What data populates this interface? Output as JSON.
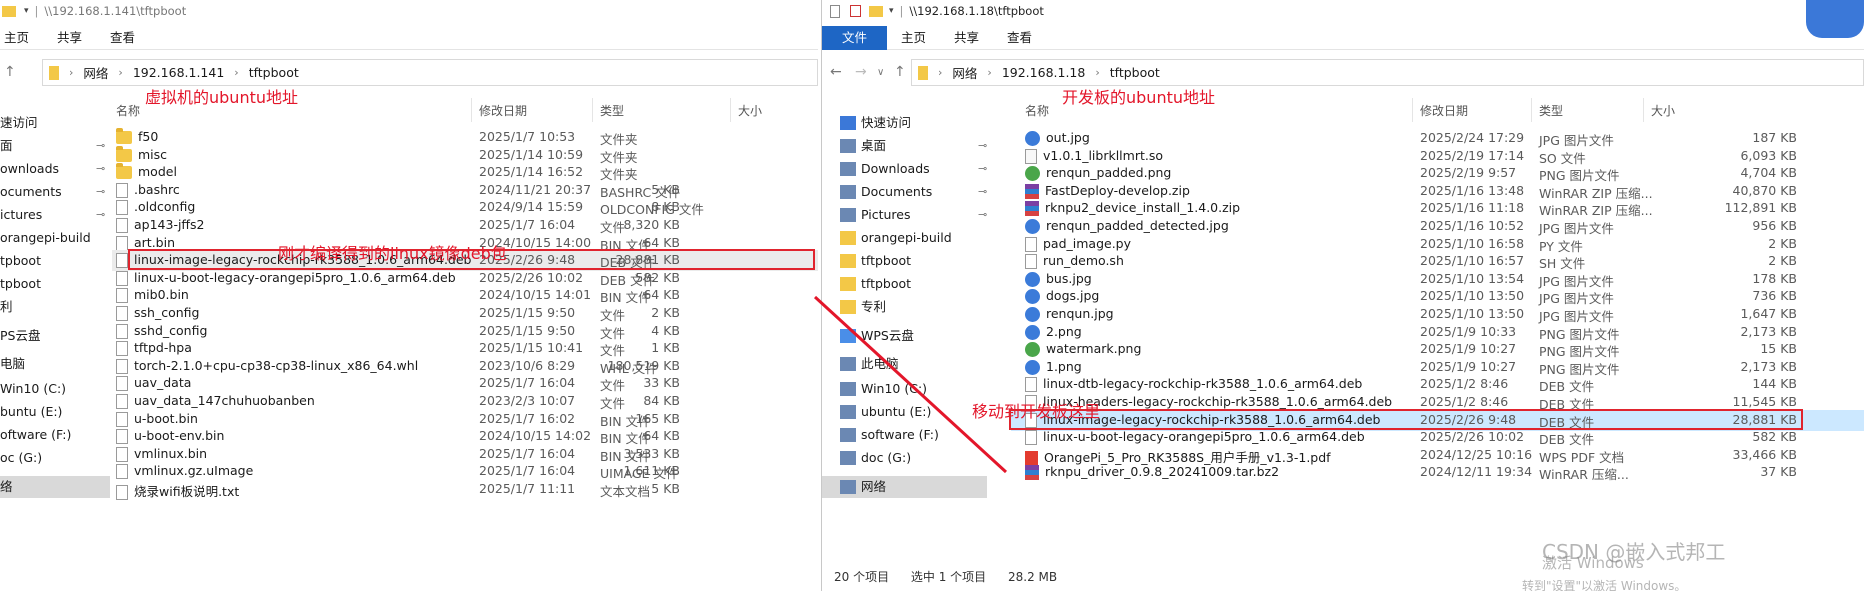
{
  "left": {
    "title": "\\\\192.168.1.141\\tftpboot",
    "ribbon": [
      "主页",
      "共享",
      "查看"
    ],
    "breadcrumb": [
      "网络",
      "192.168.1.141",
      "tftpboot"
    ],
    "columns": [
      "名称",
      "修改日期",
      "类型",
      "大小"
    ],
    "sidebar": [
      "速访问",
      "面",
      "ownloads",
      "ocuments",
      "ictures",
      "orangepi-build",
      "tpboot",
      "tpboot",
      "利",
      "PS云盘",
      "电脑",
      "Win10 (C:)",
      "buntu (E:)",
      "oftware (F:)",
      "oc (G:)",
      "络"
    ],
    "files": [
      {
        "name": "f50",
        "date": "2025/1/7 10:53",
        "type": "文件夹",
        "size": "",
        "icon": "folder"
      },
      {
        "name": "misc",
        "date": "2025/1/14 10:59",
        "type": "文件夹",
        "size": "",
        "icon": "folder"
      },
      {
        "name": "model",
        "date": "2025/1/14 16:52",
        "type": "文件夹",
        "size": "",
        "icon": "folder"
      },
      {
        "name": ".bashrc",
        "date": "2024/11/21 20:37",
        "type": "BASHRC 文件",
        "size": "5 KB",
        "icon": "doc"
      },
      {
        "name": ".oldconfig",
        "date": "2024/9/14 15:59",
        "type": "OLDCONFIG 文件",
        "size": "8 KB",
        "icon": "doc"
      },
      {
        "name": "ap143-jffs2",
        "date": "2025/1/7 16:04",
        "type": "文件",
        "size": "8,320 KB",
        "icon": "doc"
      },
      {
        "name": "art.bin",
        "date": "2024/10/15 14:00",
        "type": "BIN 文件",
        "size": "64 KB",
        "icon": "doc"
      },
      {
        "name": "linux-image-legacy-rockchip-rk3588_1.0.6_arm64.deb",
        "date": "2025/2/26 9:48",
        "type": "DEB 文件",
        "size": "28,881 KB",
        "icon": "doc"
      },
      {
        "name": "linux-u-boot-legacy-orangepi5pro_1.0.6_arm64.deb",
        "date": "2025/2/26 10:02",
        "type": "DEB 文件",
        "size": "582 KB",
        "icon": "doc"
      },
      {
        "name": "mib0.bin",
        "date": "2024/10/15 14:01",
        "type": "BIN 文件",
        "size": "64 KB",
        "icon": "doc"
      },
      {
        "name": "ssh_config",
        "date": "2025/1/15 9:50",
        "type": "文件",
        "size": "2 KB",
        "icon": "doc"
      },
      {
        "name": "sshd_config",
        "date": "2025/1/15 9:50",
        "type": "文件",
        "size": "4 KB",
        "icon": "doc"
      },
      {
        "name": "tftpd-hpa",
        "date": "2025/1/15 10:41",
        "type": "文件",
        "size": "1 KB",
        "icon": "doc"
      },
      {
        "name": "torch-2.1.0+cpu-cp38-cp38-linux_x86_64.whl",
        "date": "2023/10/6 8:29",
        "type": "WHL 文件",
        "size": "180,519 KB",
        "icon": "doc"
      },
      {
        "name": "uav_data",
        "date": "2025/1/7 16:04",
        "type": "文件",
        "size": "33 KB",
        "icon": "doc"
      },
      {
        "name": "uav_data_147chuhuobanben",
        "date": "2023/2/3 10:07",
        "type": "文件",
        "size": "84 KB",
        "icon": "doc"
      },
      {
        "name": "u-boot.bin",
        "date": "2025/1/7 16:02",
        "type": "BIN 文件",
        "size": "165 KB",
        "icon": "doc"
      },
      {
        "name": "u-boot-env.bin",
        "date": "2024/10/15 14:02",
        "type": "BIN 文件",
        "size": "64 KB",
        "icon": "doc"
      },
      {
        "name": "vmlinux.bin",
        "date": "2025/1/7 16:04",
        "type": "BIN 文件",
        "size": "3,533 KB",
        "icon": "doc"
      },
      {
        "name": "vmlinux.gz.uImage",
        "date": "2025/1/7 16:04",
        "type": "UIMAGE 文件",
        "size": "1,611 KB",
        "icon": "doc"
      },
      {
        "name": "烧录wifi板说明.txt",
        "date": "2025/1/7 11:11",
        "type": "文本文档",
        "size": "5 KB",
        "icon": "doc"
      }
    ],
    "annotation_top": "虚拟机的ubuntu地址",
    "annotation_mid": "刚才编译得到的linux镜像deb包"
  },
  "right": {
    "title": "\\\\192.168.1.18\\tftpboot",
    "ribbon": [
      "文件",
      "主页",
      "共享",
      "查看"
    ],
    "breadcrumb": [
      "网络",
      "192.168.1.18",
      "tftpboot"
    ],
    "columns": [
      "名称",
      "修改日期",
      "类型",
      "大小"
    ],
    "sidebar": [
      "快速访问",
      "桌面",
      "Downloads",
      "Documents",
      "Pictures",
      "orangepi-build",
      "tftpboot",
      "tftpboot",
      "专利",
      "WPS云盘",
      "此电脑",
      "Win10 (C:)",
      "ubuntu (E:)",
      "software (F:)",
      "doc (G:)",
      "网络"
    ],
    "files": [
      {
        "name": "out.jpg",
        "date": "2025/2/24 17:29",
        "type": "JPG 图片文件",
        "size": "187 KB",
        "icon": "img"
      },
      {
        "name": "v1.0.1_librkllmrt.so",
        "date": "2025/2/19 17:14",
        "type": "SO 文件",
        "size": "6,093 KB",
        "icon": "so"
      },
      {
        "name": "renqun_padded.png",
        "date": "2025/2/19 9:57",
        "type": "PNG 图片文件",
        "size": "4,704 KB",
        "icon": "png"
      },
      {
        "name": "FastDeploy-develop.zip",
        "date": "2025/1/16 13:48",
        "type": "WinRAR ZIP 压缩...",
        "size": "40,870 KB",
        "icon": "zip"
      },
      {
        "name": "rknpu2_device_install_1.4.0.zip",
        "date": "2025/1/16 11:18",
        "type": "WinRAR ZIP 压缩...",
        "size": "112,891 KB",
        "icon": "zip"
      },
      {
        "name": "renqun_padded_detected.jpg",
        "date": "2025/1/16 10:52",
        "type": "JPG 图片文件",
        "size": "956 KB",
        "icon": "img"
      },
      {
        "name": "pad_image.py",
        "date": "2025/1/10 16:58",
        "type": "PY 文件",
        "size": "2 KB",
        "icon": "doc"
      },
      {
        "name": "run_demo.sh",
        "date": "2025/1/10 16:57",
        "type": "SH 文件",
        "size": "2 KB",
        "icon": "doc"
      },
      {
        "name": "bus.jpg",
        "date": "2025/1/10 13:54",
        "type": "JPG 图片文件",
        "size": "178 KB",
        "icon": "img"
      },
      {
        "name": "dogs.jpg",
        "date": "2025/1/10 13:50",
        "type": "JPG 图片文件",
        "size": "736 KB",
        "icon": "img"
      },
      {
        "name": "renqun.jpg",
        "date": "2025/1/10 13:50",
        "type": "JPG 图片文件",
        "size": "1,647 KB",
        "icon": "img"
      },
      {
        "name": "2.png",
        "date": "2025/1/9 10:33",
        "type": "PNG 图片文件",
        "size": "2,173 KB",
        "icon": "img"
      },
      {
        "name": "watermark.png",
        "date": "2025/1/9 10:27",
        "type": "PNG 图片文件",
        "size": "15 KB",
        "icon": "png"
      },
      {
        "name": "1.png",
        "date": "2025/1/9 10:27",
        "type": "PNG 图片文件",
        "size": "2,173 KB",
        "icon": "img"
      },
      {
        "name": "linux-dtb-legacy-rockchip-rk3588_1.0.6_arm64.deb",
        "date": "2025/1/2 8:46",
        "type": "DEB 文件",
        "size": "144 KB",
        "icon": "doc"
      },
      {
        "name": "linux-headers-legacy-rockchip-rk3588_1.0.6_arm64.deb",
        "date": "2025/1/2 8:46",
        "type": "DEB 文件",
        "size": "11,545 KB",
        "icon": "doc"
      },
      {
        "name": "linux-image-legacy-rockchip-rk3588_1.0.6_arm64.deb",
        "date": "2025/2/26 9:48",
        "type": "DEB 文件",
        "size": "28,881 KB",
        "icon": "doc"
      },
      {
        "name": "linux-u-boot-legacy-orangepi5pro_1.0.6_arm64.deb",
        "date": "2025/2/26 10:02",
        "type": "DEB 文件",
        "size": "582 KB",
        "icon": "doc"
      },
      {
        "name": "OrangePi_5_Pro_RK3588S_用户手册_v1.3-1.pdf",
        "date": "2024/12/25 10:16",
        "type": "WPS PDF 文档",
        "size": "33,466 KB",
        "icon": "pdf"
      },
      {
        "name": "rknpu_driver_0.9.8_20241009.tar.bz2",
        "date": "2024/12/11 19:34",
        "type": "WinRAR 压缩...",
        "size": "37 KB",
        "icon": "zip"
      }
    ],
    "status": [
      "20 个项目",
      "选中 1 个项目",
      "28.2 MB"
    ],
    "annotation_top": "开发板的ubuntu地址",
    "annotation_mid": "移动到开发板这里",
    "watermark_csdn": "CSDN @嵌入式邦工",
    "watermark_win": "激活 Windows",
    "watermark_win2": "转到\"设置\"以激活 Windows。"
  }
}
